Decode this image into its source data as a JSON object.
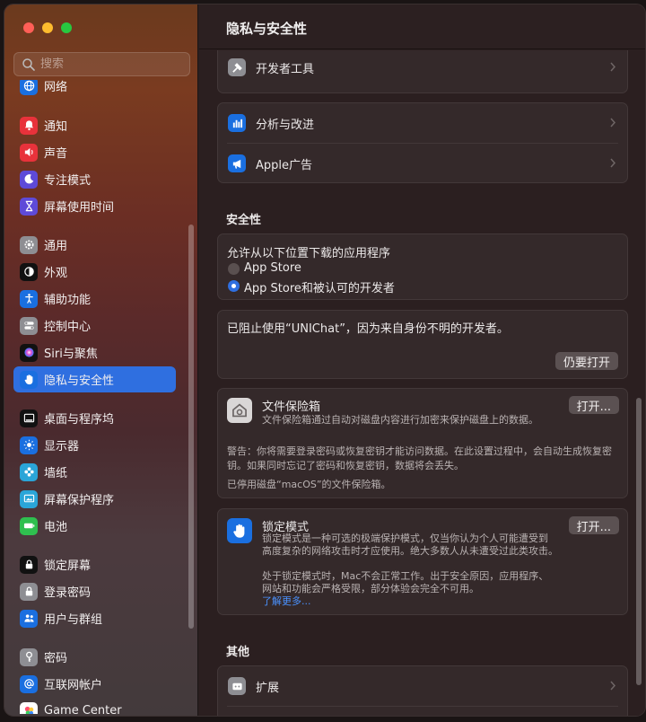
{
  "sidebar": {
    "search_placeholder": "搜索",
    "items": [
      {
        "label": "网络",
        "color": "#1a6fe0"
      },
      {
        "label": "通知",
        "color": "#e8323b"
      },
      {
        "label": "声音",
        "color": "#e8323b"
      },
      {
        "label": "专注模式",
        "color": "#5e4ad8"
      },
      {
        "label": "屏幕使用时间",
        "color": "#5e4ad8"
      },
      {
        "label": "通用",
        "color": "#8e8e93"
      },
      {
        "label": "外观",
        "color": "#111111"
      },
      {
        "label": "辅助功能",
        "color": "#1a6fe0"
      },
      {
        "label": "控制中心",
        "color": "#8e8e93"
      },
      {
        "label": "Siri与聚焦",
        "color": "#111111"
      },
      {
        "label": "隐私与安全性",
        "color": "#1a6fe0"
      },
      {
        "label": "桌面与程序坞",
        "color": "#111111"
      },
      {
        "label": "显示器",
        "color": "#1a6fe0"
      },
      {
        "label": "墙纸",
        "color": "#2aa5d8"
      },
      {
        "label": "屏幕保护程序",
        "color": "#2aa5d8"
      },
      {
        "label": "电池",
        "color": "#2fbf4f"
      },
      {
        "label": "锁定屏幕",
        "color": "#111111"
      },
      {
        "label": "登录密码",
        "color": "#8e8e93"
      },
      {
        "label": "用户与群组",
        "color": "#1a6fe0"
      },
      {
        "label": "密码",
        "color": "#8e8e93"
      },
      {
        "label": "互联网帐户",
        "color": "#1a6fe0"
      },
      {
        "label": "Game Center",
        "color": "#ffffff"
      }
    ],
    "active_item": "隐私与安全性"
  },
  "header": {
    "title": "隐私与安全性"
  },
  "main": {
    "dev_tools": "开发者工具",
    "analytics": "分析与改进",
    "apple_ads": "Apple广告",
    "security_title": "安全性",
    "download_heading": "允许从以下位置下载的应用程序",
    "option_store": "App Store",
    "option_store_dev": "App Store和被认可的开发者",
    "blocked_msg": "已阻止使用“UNIChat”，因为来自身份不明的开发者。",
    "open_anyway": "仍要打开",
    "filevault_title": "文件保险箱",
    "filevault_desc": "文件保险箱通过自动对磁盘内容进行加密来保护磁盘上的数据。",
    "filevault_btn": "打开...",
    "filevault_warning_1": "警告：你将需要登录密码或恢复密钥才能访问数据。在此设置过程中，会自动生成恢复密",
    "filevault_warning_2": "钥。如果同时忘记了密码和恢复密钥，数据将会丢失。",
    "filevault_status": "已停用磁盘“macOS”的文件保险箱。",
    "lockdown_title": "锁定模式",
    "lockdown_desc_1": "锁定模式是一种可选的极端保护模式，仅当你认为个人可能遭受到",
    "lockdown_desc_2": "高度复杂的网络攻击时才应使用。绝大多数人从未遭受过此类攻击。",
    "lockdown_note_1": "处于锁定模式时，Mac不会正常工作。出于安全原因，应用程序、",
    "lockdown_note_2": "网站和功能会严格受限，部分体验会完全不可用。",
    "learn_more": "了解更多...",
    "lockdown_btn": "打开...",
    "other_title": "其他",
    "extensions": "扩展"
  },
  "colors": {
    "accent": "#2f6fe0",
    "link": "#4a92ff"
  }
}
